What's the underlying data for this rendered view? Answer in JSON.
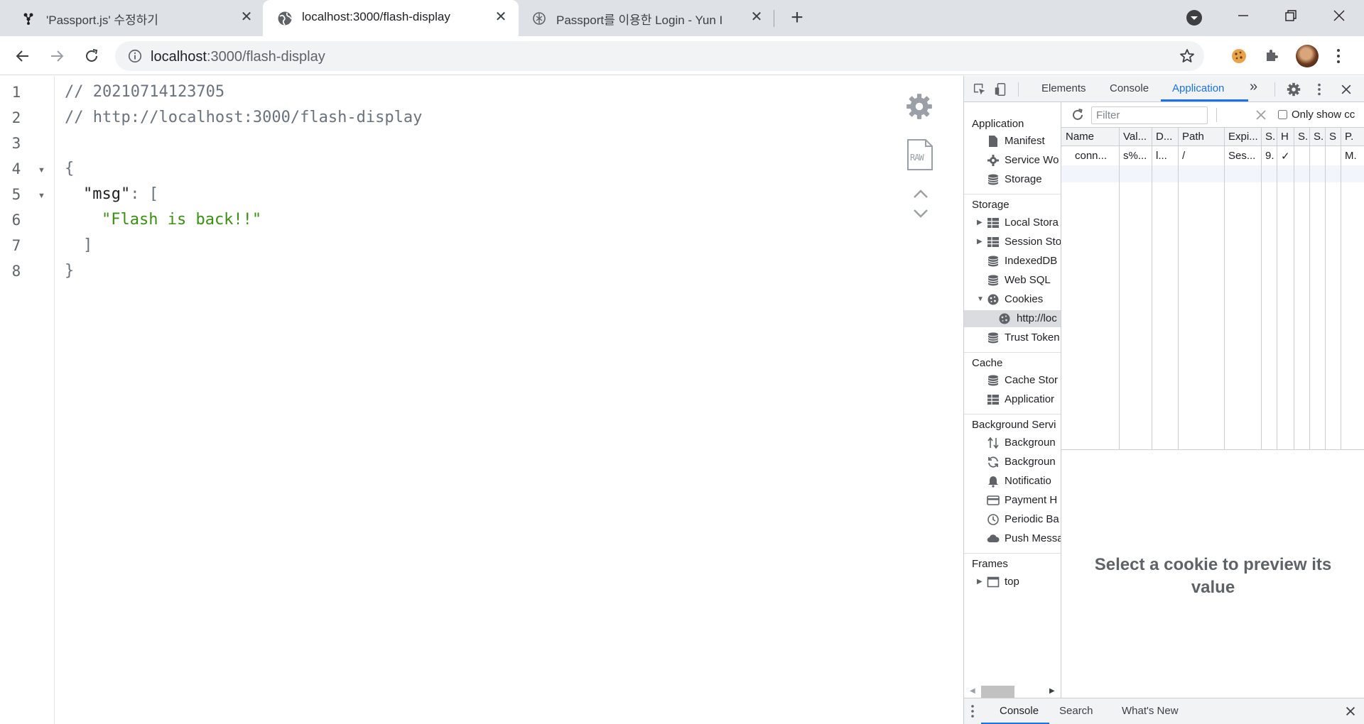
{
  "tabs": [
    {
      "label": "'Passport.js' 수정하기",
      "icon": "velog-icon",
      "active": false
    },
    {
      "label": "localhost:3000/flash-display",
      "icon": "globe-icon",
      "active": true
    },
    {
      "label": "Passport를 이용한 Login - Yun I",
      "icon": "openai-icon",
      "active": false
    }
  ],
  "toolbar": {
    "url_host": "localhost",
    "url_path": ":3000/flash-display"
  },
  "editor": {
    "line_numbers": [
      "1",
      "2",
      "3",
      "4",
      "5",
      "6",
      "7",
      "8"
    ],
    "lines": {
      "l1": "// 20210714123705",
      "l2": "// http://localhost:3000/flash-display",
      "l4_brace": "{",
      "l5_key": "\"msg\"",
      "l5_colon": ": ",
      "l5_bracket": "[",
      "l6_str": "\"Flash is back!!\"",
      "l7_bracket": "]",
      "l8_brace": "}"
    },
    "raw_label": "RAW"
  },
  "devtools": {
    "tabs": [
      "Elements",
      "Console",
      "Application"
    ],
    "more": "»",
    "sidebar": {
      "application_title": "Application",
      "application_items": [
        "Manifest",
        "Service Wo",
        "Storage"
      ],
      "storage_title": "Storage",
      "storage_items": [
        "Local Stora",
        "Session Sto",
        "IndexedDB",
        "Web SQL",
        "Cookies",
        "http://loc",
        "Trust Token"
      ],
      "cache_title": "Cache",
      "cache_items": [
        "Cache Stor",
        "Applicatior"
      ],
      "bg_title": "Background Servi",
      "bg_items": [
        "Backgroun",
        "Backgroun",
        "Notificatio",
        "Payment H",
        "Periodic Ba",
        "Push Messa"
      ],
      "frames_title": "Frames",
      "frames_items": [
        "top"
      ]
    },
    "cookies": {
      "filter_placeholder": "Filter",
      "only_show": "Only show cc",
      "columns": [
        "Name",
        "Val...",
        "D...",
        "Path",
        "Expi...",
        "S.",
        "H",
        "S.",
        "S.",
        "S",
        "P."
      ],
      "row": [
        "conn...",
        "s%...",
        "l...",
        "/",
        "Ses...",
        "9.",
        "✓",
        "",
        "",
        "",
        "M."
      ]
    },
    "preview_text": "Select a cookie to preview its value",
    "drawer_tabs": [
      "Console",
      "Search",
      "What's New"
    ]
  }
}
